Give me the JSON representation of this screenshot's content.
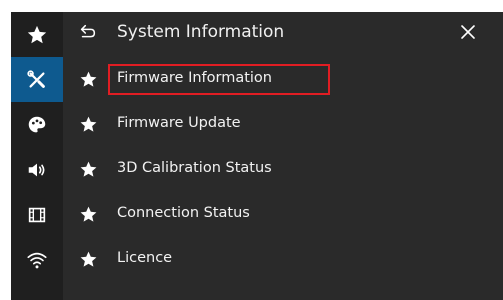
{
  "header": {
    "title": "System Information",
    "back_icon": "return-arrow-icon",
    "close_icon": "close-icon"
  },
  "sidebar": {
    "items": [
      {
        "icon": "star-icon",
        "active": false
      },
      {
        "icon": "tools-icon",
        "active": true
      },
      {
        "icon": "palette-icon",
        "active": false
      },
      {
        "icon": "speaker-icon",
        "active": false
      },
      {
        "icon": "film-icon",
        "active": false
      },
      {
        "icon": "wifi-icon",
        "active": false
      }
    ]
  },
  "menu": {
    "items": [
      {
        "label": "Firmware Information",
        "icon": "star-icon",
        "highlighted": true
      },
      {
        "label": "Firmware Update",
        "icon": "star-icon",
        "highlighted": false
      },
      {
        "label": "3D Calibration Status",
        "icon": "star-icon",
        "highlighted": false
      },
      {
        "label": "Connection Status",
        "icon": "star-icon",
        "highlighted": false
      },
      {
        "label": "Licence",
        "icon": "star-icon",
        "highlighted": false
      }
    ]
  },
  "colors": {
    "active_sidebar": "#0e5a8f",
    "highlight_border": "#e11d23",
    "background": "#2a2a2a",
    "text": "#f2f2f2"
  }
}
